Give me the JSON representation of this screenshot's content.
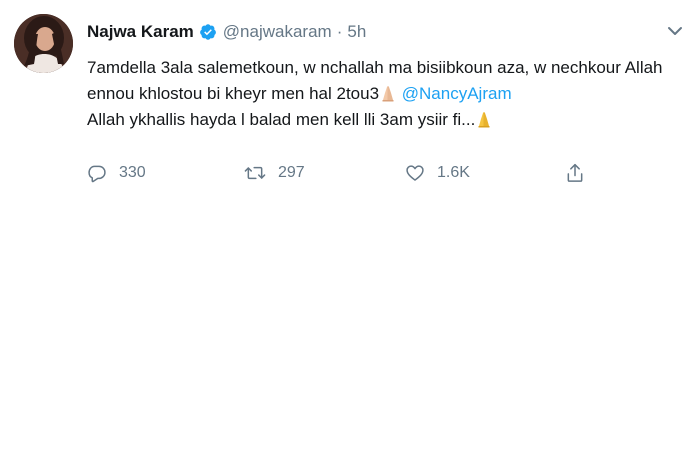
{
  "tweet": {
    "author_name": "Najwa Karam",
    "handle": "@najwakaram",
    "separator": "·",
    "time": "5h",
    "line1": "7amdella 3ala salemetkoun, w nchallah ma bisiibkoun aza, w nechkour Allah",
    "line2_text": "ennou khlostou bi kheyr men hal 2tou3",
    "mention": "@NancyAjram",
    "line3_text": "Allah ykhallis hayda l balad men kell lli 3am ysiir fi...",
    "icons": {
      "verified": "verified-badge-icon",
      "caret": "chevron-down-icon",
      "emoji": "folded-hands-emoji"
    }
  },
  "actions": {
    "reply_count": "330",
    "retweet_count": "297",
    "like_count": "1.6K"
  },
  "colors": {
    "accent": "#1da1f2",
    "text": "#14171a",
    "muted": "#657786"
  }
}
